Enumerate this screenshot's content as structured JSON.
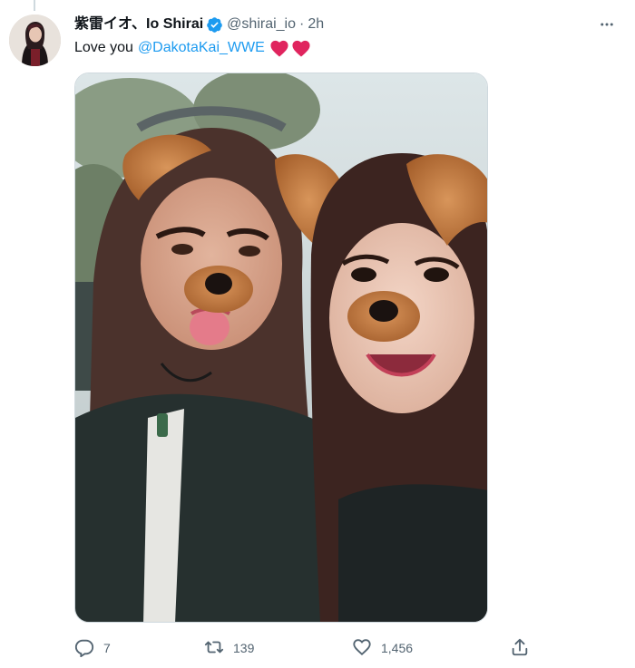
{
  "tweet": {
    "author": {
      "display_name": "紫雷イオ、Io Shirai",
      "handle": "@shirai_io",
      "verified": true
    },
    "separator": "·",
    "time": "2h",
    "text": "Love you",
    "mention": "@DakotaKai_WWE",
    "emojis": [
      "red-heart",
      "red-heart"
    ],
    "media": {
      "type": "photo"
    },
    "actions": {
      "reply_count": "7",
      "retweet_count": "139",
      "like_count": "1,456"
    }
  },
  "colors": {
    "text_primary": "#0f1419",
    "text_secondary": "#536471",
    "link": "#1d9bf0",
    "verified_badge": "#1d9bf0",
    "heart": "#e0245e",
    "border": "#cfd9de"
  },
  "icons": {
    "more": "more-dots-icon",
    "verified": "verified-badge-icon",
    "reply": "reply-icon",
    "retweet": "retweet-icon",
    "like": "like-icon",
    "share": "share-icon"
  }
}
